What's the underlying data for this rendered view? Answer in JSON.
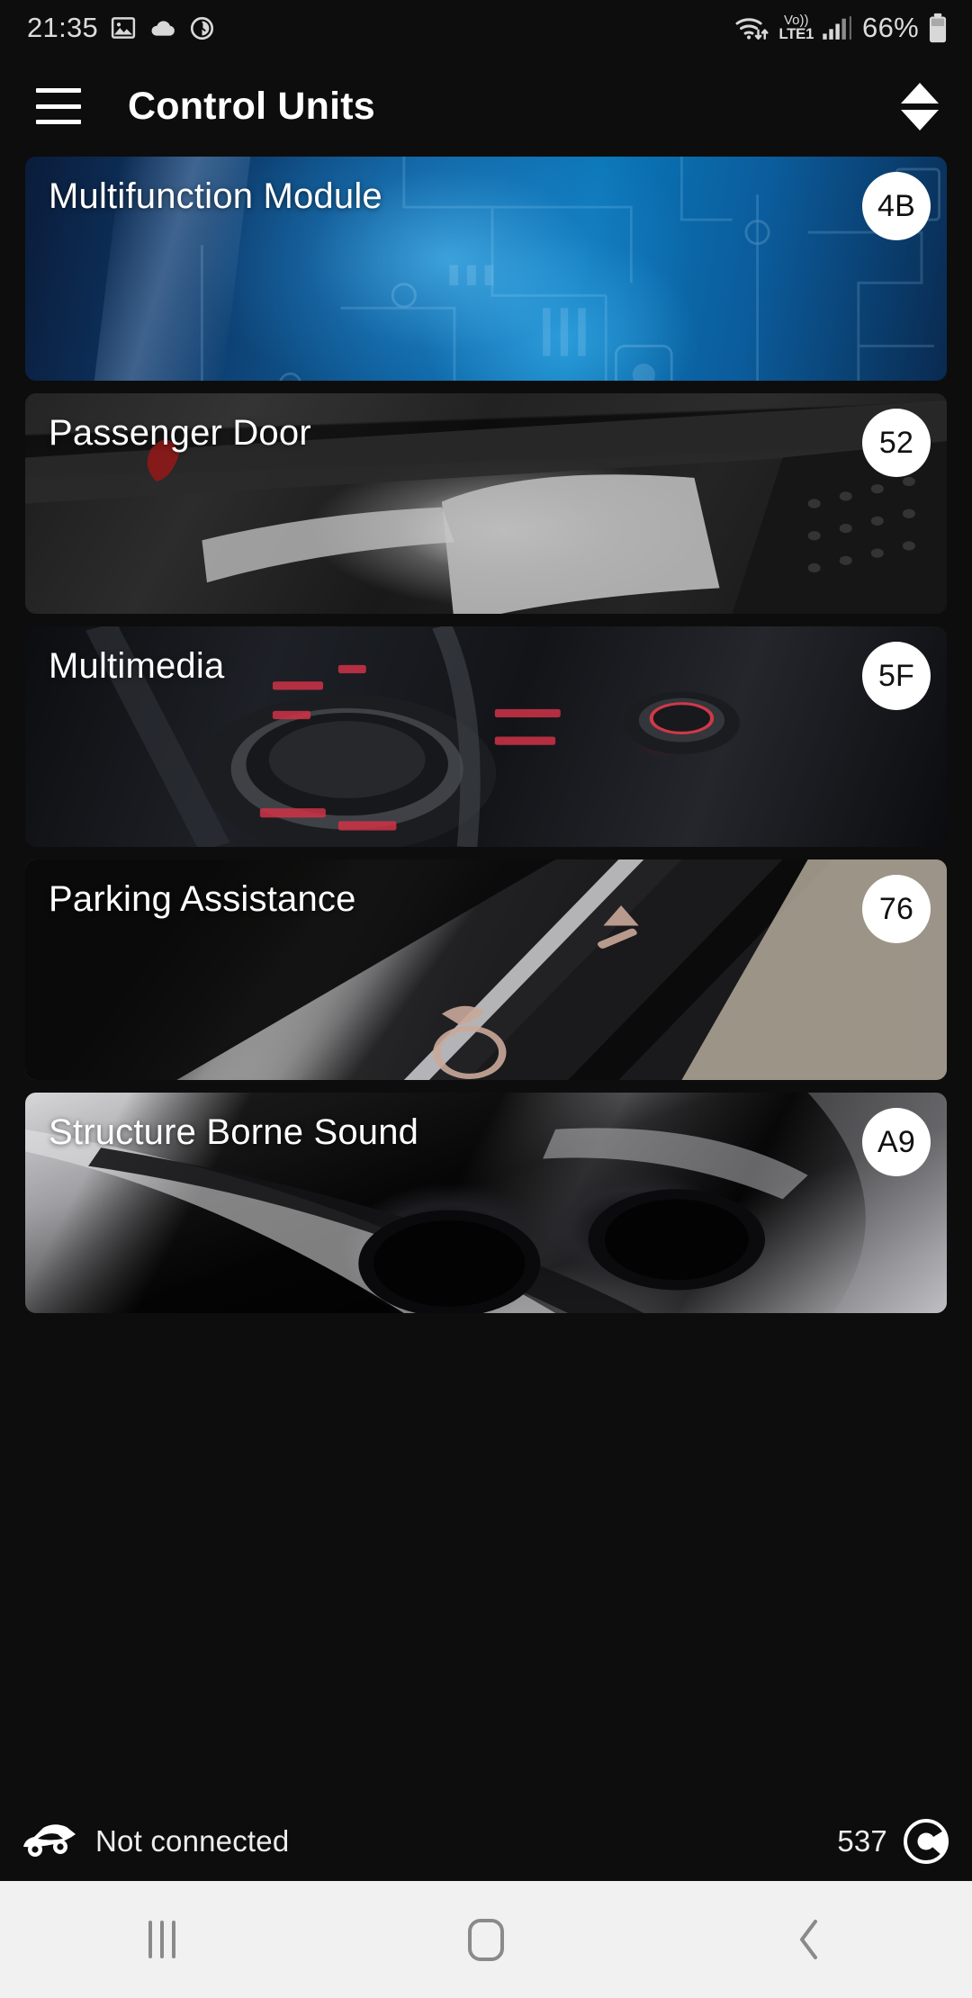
{
  "status_bar": {
    "clock": "21:35",
    "left_icons": [
      "image-icon",
      "cloud-icon",
      "clock-alarm-icon"
    ],
    "wifi_icon": "wifi-data-icon",
    "volte_top": "Vo))",
    "volte_bottom": "LTE1",
    "signal_icon": "cellular-signal-icon",
    "battery_percent": "66%",
    "battery_icon": "battery-icon"
  },
  "app_bar": {
    "menu_icon": "hamburger-menu-icon",
    "title": "Control Units",
    "sort_icon": "sort-updown-icon"
  },
  "control_units": [
    {
      "name": "Multifunction Module",
      "address": "4B",
      "image": "circuit-board-blue"
    },
    {
      "name": "Passenger Door",
      "address": "52",
      "image": "car-door-handle"
    },
    {
      "name": "Multimedia",
      "address": "5F",
      "image": "mmi-control-knob"
    },
    {
      "name": "Parking Assistance",
      "address": "76",
      "image": "pdc-pla-buttons"
    },
    {
      "name": "Structure Borne Sound",
      "address": "A9",
      "image": "exhaust-tailpipes"
    }
  ],
  "connection_bar": {
    "car_icon": "car-icon",
    "status_text": "Not connected",
    "count": "537",
    "brand_icon": "carista-logo-icon"
  },
  "nav_bar": {
    "recents_label": "recents-icon",
    "home_label": "home-icon",
    "back_label": "back-icon"
  },
  "colors": {
    "background": "#0d0d0d",
    "badge_bg": "#ffffff",
    "badge_text": "#111111",
    "title_text": "#ffffff",
    "navbar_bg": "#f1f1f1"
  }
}
